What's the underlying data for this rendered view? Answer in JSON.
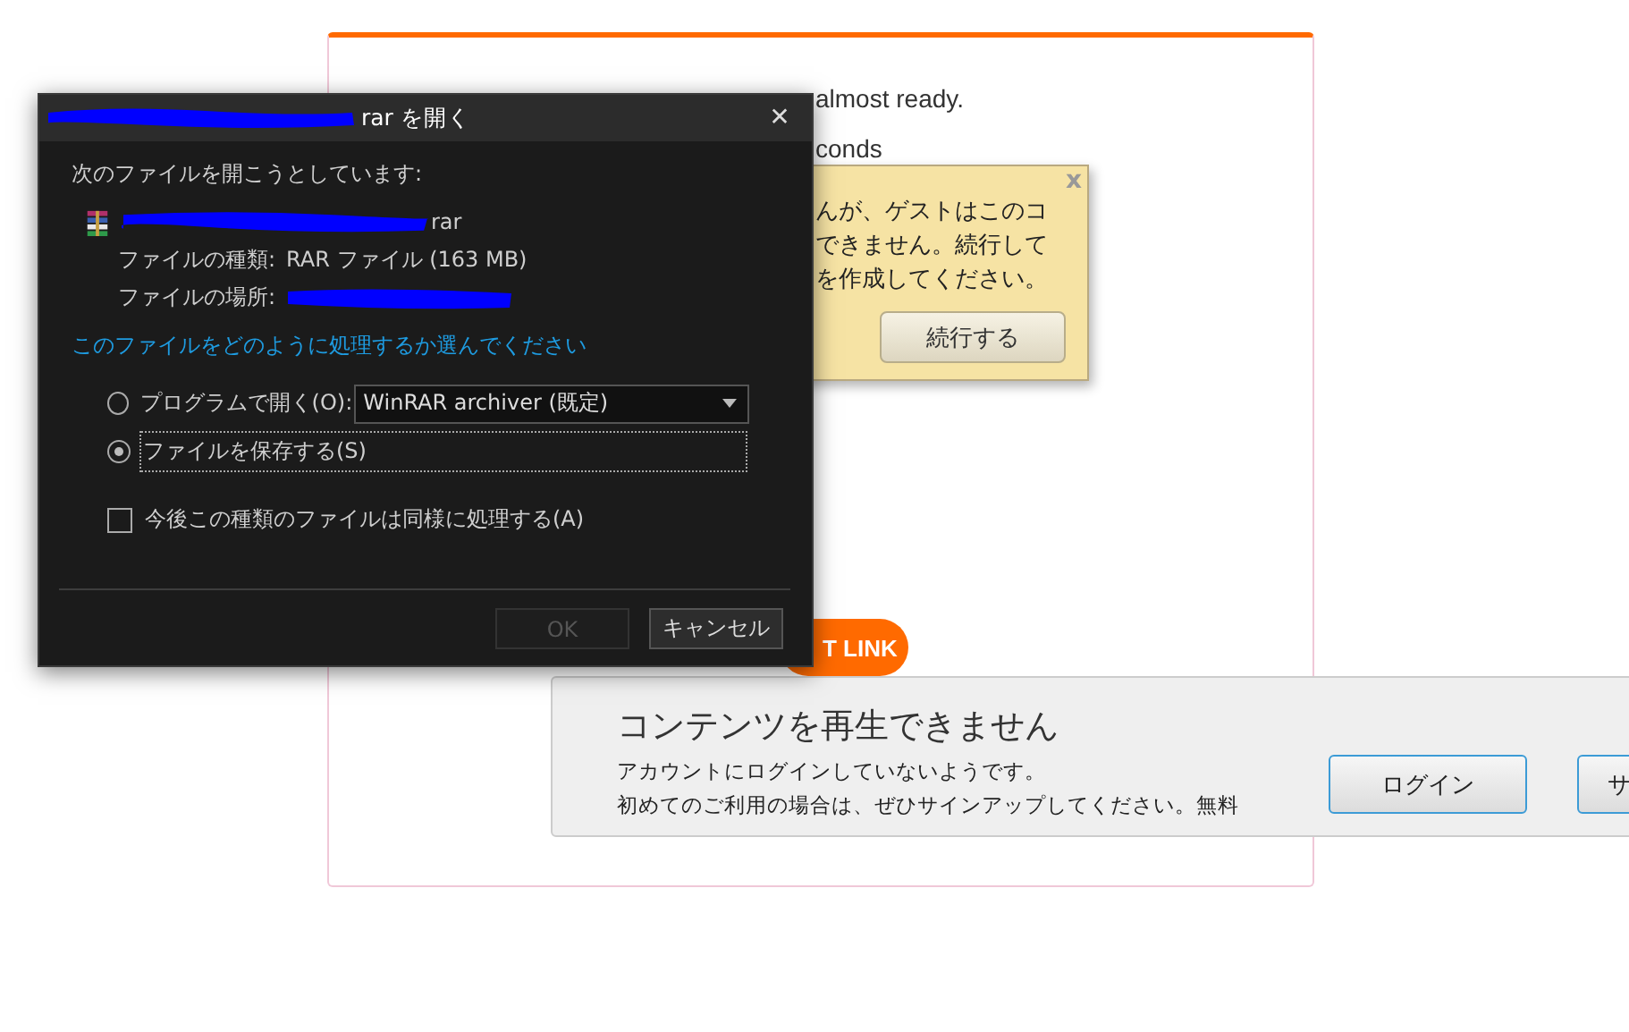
{
  "background_page": {
    "status": "almost ready.",
    "countdown": "conds",
    "get_link_button": "T LINK"
  },
  "guest_popup": {
    "close": "x",
    "lines": [
      "んが、ゲストはこのコ",
      "できません。続行して",
      "を作成してください。"
    ],
    "continue_button": "続行する"
  },
  "dialog": {
    "title": "rar を開く",
    "close": "✕",
    "prompt": "次のファイルを開こうとしています:",
    "file_name": "rar",
    "type_label": "ファイルの種類:",
    "type_value": "RAR ファイル (163 MB)",
    "location_label": "ファイルの場所:",
    "question": "このファイルをどのように処理するか選んでください",
    "options": [
      {
        "kind": "open",
        "label": "プログラムで開く(O):",
        "selected": false
      },
      {
        "kind": "save",
        "label": "ファイルを保存する(S)",
        "selected": true
      }
    ],
    "program": "WinRAR archiver (既定)",
    "remember": {
      "label": "今後この種類のファイルは同様に処理する(A)",
      "checked": false
    },
    "ok_button": {
      "label": "OK",
      "disabled": true
    },
    "cancel_button": "キャンセル"
  },
  "login_bar": {
    "title": "コンテンツを再生できません",
    "lines": [
      "アカウントにログインしていないようです。",
      "初めてのご利用の場合は、ぜひサインアップしてください。無料"
    ],
    "buttons": [
      "ログイン",
      "サ"
    ]
  }
}
